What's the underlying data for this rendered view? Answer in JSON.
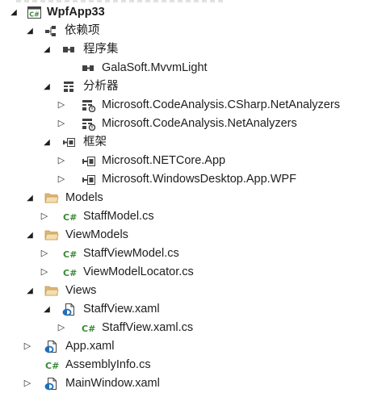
{
  "tree": {
    "project": {
      "label": "WpfApp33",
      "icon": "csharp-project-icon"
    },
    "dependencies": {
      "label": "依赖项",
      "icon": "dependencies-icon"
    },
    "assemblies": {
      "label": "程序集",
      "icon": "assemblies-icon"
    },
    "mvvmlight": {
      "label": "GalaSoft.MvvmLight",
      "icon": "assembly-reference-icon"
    },
    "analyzers": {
      "label": "分析器",
      "icon": "analyzers-icon"
    },
    "analyzer_csharp": {
      "label": "Microsoft.CodeAnalysis.CSharp.NetAnalyzers",
      "icon": "analyzer-icon"
    },
    "analyzer_net": {
      "label": "Microsoft.CodeAnalysis.NetAnalyzers",
      "icon": "analyzer-icon"
    },
    "frameworks": {
      "label": "框架",
      "icon": "frameworks-icon"
    },
    "fw_netcore": {
      "label": "Microsoft.NETCore.App",
      "icon": "framework-reference-icon"
    },
    "fw_desktop": {
      "label": "Microsoft.WindowsDesktop.App.WPF",
      "icon": "framework-reference-icon"
    },
    "models": {
      "label": "Models",
      "icon": "folder-icon"
    },
    "staffmodel": {
      "label": "StaffModel.cs",
      "icon": "csharp-file-icon"
    },
    "viewmodels": {
      "label": "ViewModels",
      "icon": "folder-icon"
    },
    "staffviewmodel": {
      "label": "StaffViewModel.cs",
      "icon": "csharp-file-icon"
    },
    "viewmodellocator": {
      "label": "ViewModelLocator.cs",
      "icon": "csharp-file-icon"
    },
    "views": {
      "label": "Views",
      "icon": "folder-icon"
    },
    "staffview_xaml": {
      "label": "StaffView.xaml",
      "icon": "xaml-file-icon"
    },
    "staffview_cs": {
      "label": "StaffView.xaml.cs",
      "icon": "csharp-file-icon"
    },
    "app_xaml": {
      "label": "App.xaml",
      "icon": "xaml-file-icon"
    },
    "assemblyinfo": {
      "label": "AssemblyInfo.cs",
      "icon": "csharp-file-icon"
    },
    "mainwindow": {
      "label": "MainWindow.xaml",
      "icon": "xaml-file-icon"
    }
  },
  "colors": {
    "csharp_green": "#388a34",
    "folder_tan": "#dcb67a",
    "xaml_blue": "#1e6fb8",
    "icon_dark": "#424242"
  }
}
